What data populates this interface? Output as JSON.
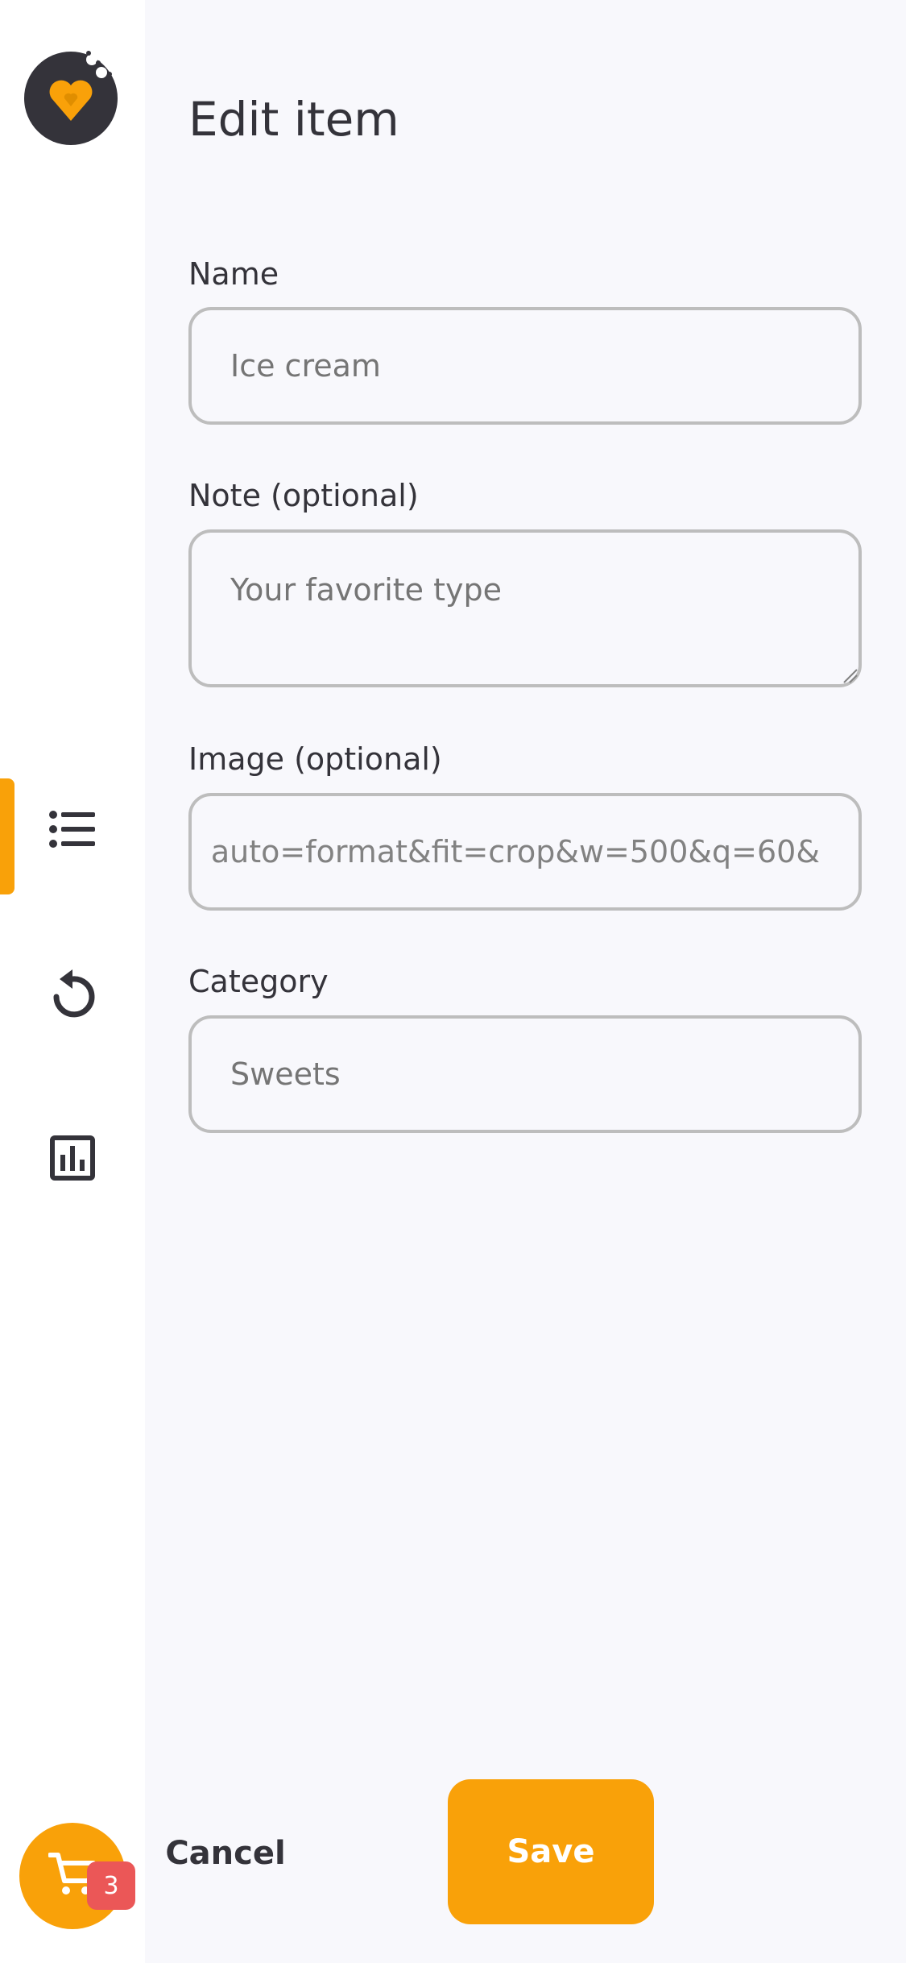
{
  "app": {
    "logo_icon": "heart-logo-icon",
    "nav_items": [
      {
        "id": "list",
        "icon": "list-icon",
        "active": true
      },
      {
        "id": "history",
        "icon": "history-icon",
        "active": false
      },
      {
        "id": "statistics",
        "icon": "bar-chart-icon",
        "active": false
      }
    ],
    "cart": {
      "icon": "cart-icon",
      "count": "3"
    }
  },
  "form": {
    "title": "Edit item",
    "name": {
      "label": "Name",
      "placeholder": "Ice cream",
      "value": ""
    },
    "note": {
      "label": "Note (optional)",
      "placeholder": "Your favorite type",
      "value": ""
    },
    "image": {
      "label": "Image (optional)",
      "value": "&auto=format&fit=crop&w=500&q=60"
    },
    "category": {
      "label": "Category",
      "placeholder": "Sweets",
      "value": ""
    }
  },
  "actions": {
    "cancel_label": "Cancel",
    "save_label": "Save"
  },
  "colors": {
    "accent": "#F9A109",
    "dark": "#34333A",
    "badge": "#EB5757",
    "main_background": "#F8F8FC",
    "border": "#BDBDBD"
  }
}
